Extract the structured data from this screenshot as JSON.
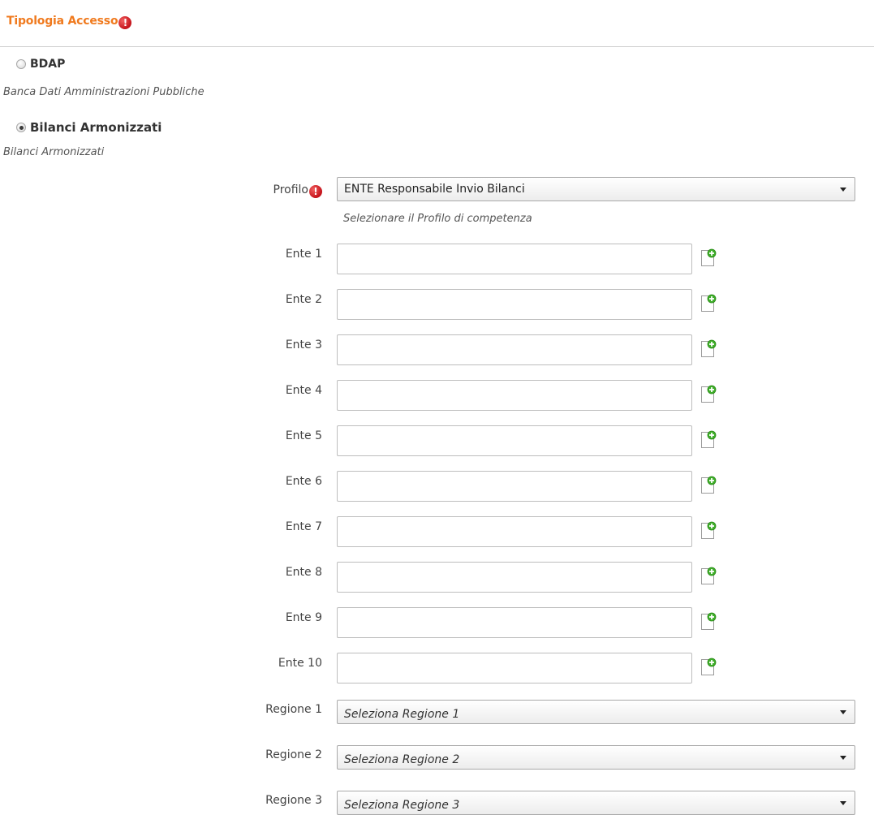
{
  "section": {
    "title": "Tipologia Accesso"
  },
  "access_types": [
    {
      "label": "BDAP",
      "description": "Banca Dati Amministrazioni Pubbliche",
      "selected": false
    },
    {
      "label": "Bilanci Armonizzati",
      "description": "Bilanci Armonizzati",
      "selected": true
    }
  ],
  "profilo": {
    "label": "Profilo",
    "value": "ENTE Responsabile Invio Bilanci",
    "hint": "Selezionare il Profilo di competenza"
  },
  "enti": [
    {
      "label": "Ente 1",
      "value": ""
    },
    {
      "label": "Ente 2",
      "value": ""
    },
    {
      "label": "Ente 3",
      "value": ""
    },
    {
      "label": "Ente 4",
      "value": ""
    },
    {
      "label": "Ente 5",
      "value": ""
    },
    {
      "label": "Ente 6",
      "value": ""
    },
    {
      "label": "Ente 7",
      "value": ""
    },
    {
      "label": "Ente 8",
      "value": ""
    },
    {
      "label": "Ente 9",
      "value": ""
    },
    {
      "label": "Ente 10",
      "value": ""
    }
  ],
  "regioni": [
    {
      "label": "Regione 1",
      "placeholder": "Seleziona Regione 1"
    },
    {
      "label": "Regione 2",
      "placeholder": "Seleziona Regione 2"
    },
    {
      "label": "Regione 3",
      "placeholder": "Seleziona Regione 3"
    }
  ],
  "icons": {
    "required": "alert-icon",
    "add": "add-document-icon"
  },
  "colors": {
    "section_title": "#f07a1e",
    "required_icon": "#c4121a",
    "add_icon": "#3fae2a"
  }
}
